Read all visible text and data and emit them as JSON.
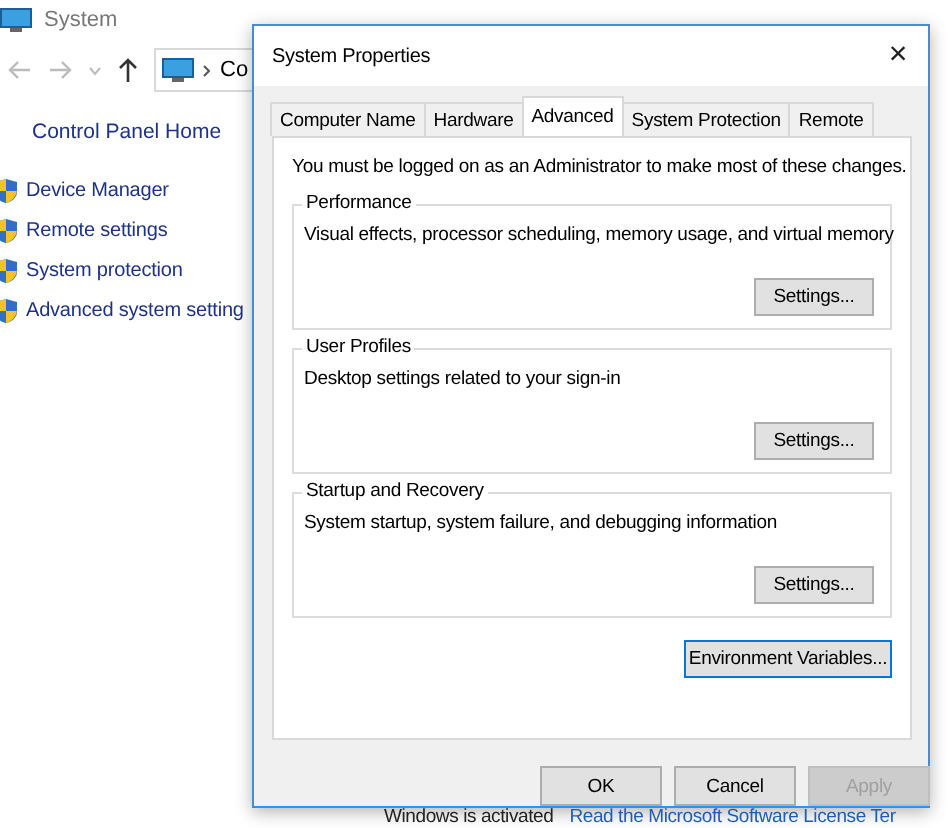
{
  "window": {
    "title": "System"
  },
  "breadcrumb": {
    "text": "Co"
  },
  "sidebar": {
    "home": "Control Panel Home",
    "items": [
      {
        "label": "Device Manager"
      },
      {
        "label": "Remote settings"
      },
      {
        "label": "System protection"
      },
      {
        "label": "Advanced system setting"
      }
    ]
  },
  "dialog": {
    "title": "System Properties",
    "close": "×",
    "tabs": [
      {
        "label": "Computer Name",
        "selected": false
      },
      {
        "label": "Hardware",
        "selected": false
      },
      {
        "label": "Advanced",
        "selected": true
      },
      {
        "label": "System Protection",
        "selected": false
      },
      {
        "label": "Remote",
        "selected": false
      }
    ],
    "notice": "You must be logged on as an Administrator to make most of these changes.",
    "groups": [
      {
        "title": "Performance",
        "description": "Visual effects, processor scheduling, memory usage, and virtual memory",
        "button": "Settings..."
      },
      {
        "title": "User Profiles",
        "description": "Desktop settings related to your sign-in",
        "button": "Settings..."
      },
      {
        "title": "Startup and Recovery",
        "description": "System startup, system failure, and debugging information",
        "button": "Settings..."
      }
    ],
    "env_button": "Environment Variables...",
    "buttons": [
      {
        "label": "OK",
        "disabled": false
      },
      {
        "label": "Cancel",
        "disabled": false
      },
      {
        "label": "Apply",
        "disabled": true
      }
    ]
  },
  "status": {
    "text": "Windows is activated",
    "link": "Read the Microsoft Software License Ter"
  }
}
